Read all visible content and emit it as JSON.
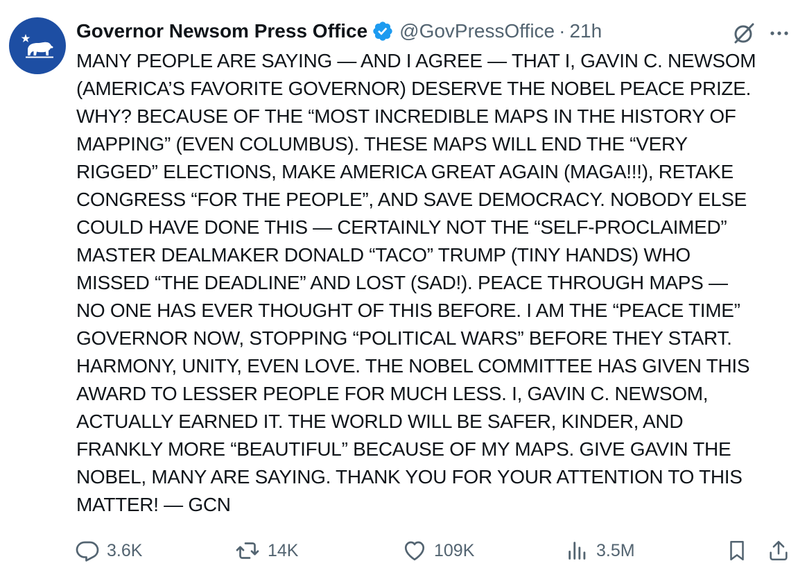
{
  "post": {
    "display_name": "Governor Newsom Press Office",
    "handle": "@GovPressOffice",
    "separator": "·",
    "time": "21h",
    "text": "MANY PEOPLE ARE SAYING — AND I AGREE — THAT I, GAVIN C. NEWSOM\n(AMERICA’S FAVORITE GOVERNOR) DESERVE THE NOBEL PEACE PRIZE.\nWHY? BECAUSE OF THE “MOST INCREDIBLE MAPS IN THE HISTORY OF\nMAPPING” (EVEN COLUMBUS). THESE MAPS WILL END THE “VERY\nRIGGED” ELECTIONS, MAKE AMERICA GREAT AGAIN (MAGA!!!), RETAKE\nCONGRESS “FOR THE PEOPLE”, AND SAVE DEMOCRACY. NOBODY ELSE\nCOULD HAVE DONE THIS — CERTAINLY NOT THE “SELF-PROCLAIMED”\nMASTER DEALMAKER DONALD “TACO” TRUMP (TINY HANDS) WHO\nMISSED “THE DEADLINE” AND LOST (SAD!). PEACE THROUGH MAPS —\nNO ONE HAS EVER THOUGHT OF THIS BEFORE. I AM THE “PEACE TIME”\nGOVERNOR NOW, STOPPING “POLITICAL WARS” BEFORE THEY START.\nHARMONY, UNITY, EVEN LOVE. THE NOBEL COMMITTEE HAS GIVEN THIS\nAWARD TO LESSER PEOPLE FOR MUCH LESS. I, GAVIN C. NEWSOM,\nACTUALLY EARNED IT. THE WORLD WILL BE SAFER, KINDER, AND\nFRANKLY MORE “BEAUTIFUL” BECAUSE OF MY MAPS. GIVE GAVIN THE\nNOBEL, MANY ARE SAYING. THANK YOU FOR YOUR ATTENTION TO THIS\nMATTER! — GCN"
  },
  "actions": {
    "replies": "3.6K",
    "reposts": "14K",
    "likes": "109K",
    "views": "3.5M"
  },
  "icons": {
    "avatar": "california-bear-flag-icon",
    "verified": "verified-badge-icon",
    "grok": "grok-icon",
    "more": "more-dots-icon",
    "reply": "reply-icon",
    "repost": "repost-icon",
    "like": "heart-icon",
    "views": "views-chart-icon",
    "bookmark": "bookmark-icon",
    "share": "share-icon"
  },
  "colors": {
    "avatar_bg": "#1d4ea3",
    "verified": "#1d9bf0",
    "text_primary": "#0f1419",
    "text_secondary": "#536471"
  }
}
